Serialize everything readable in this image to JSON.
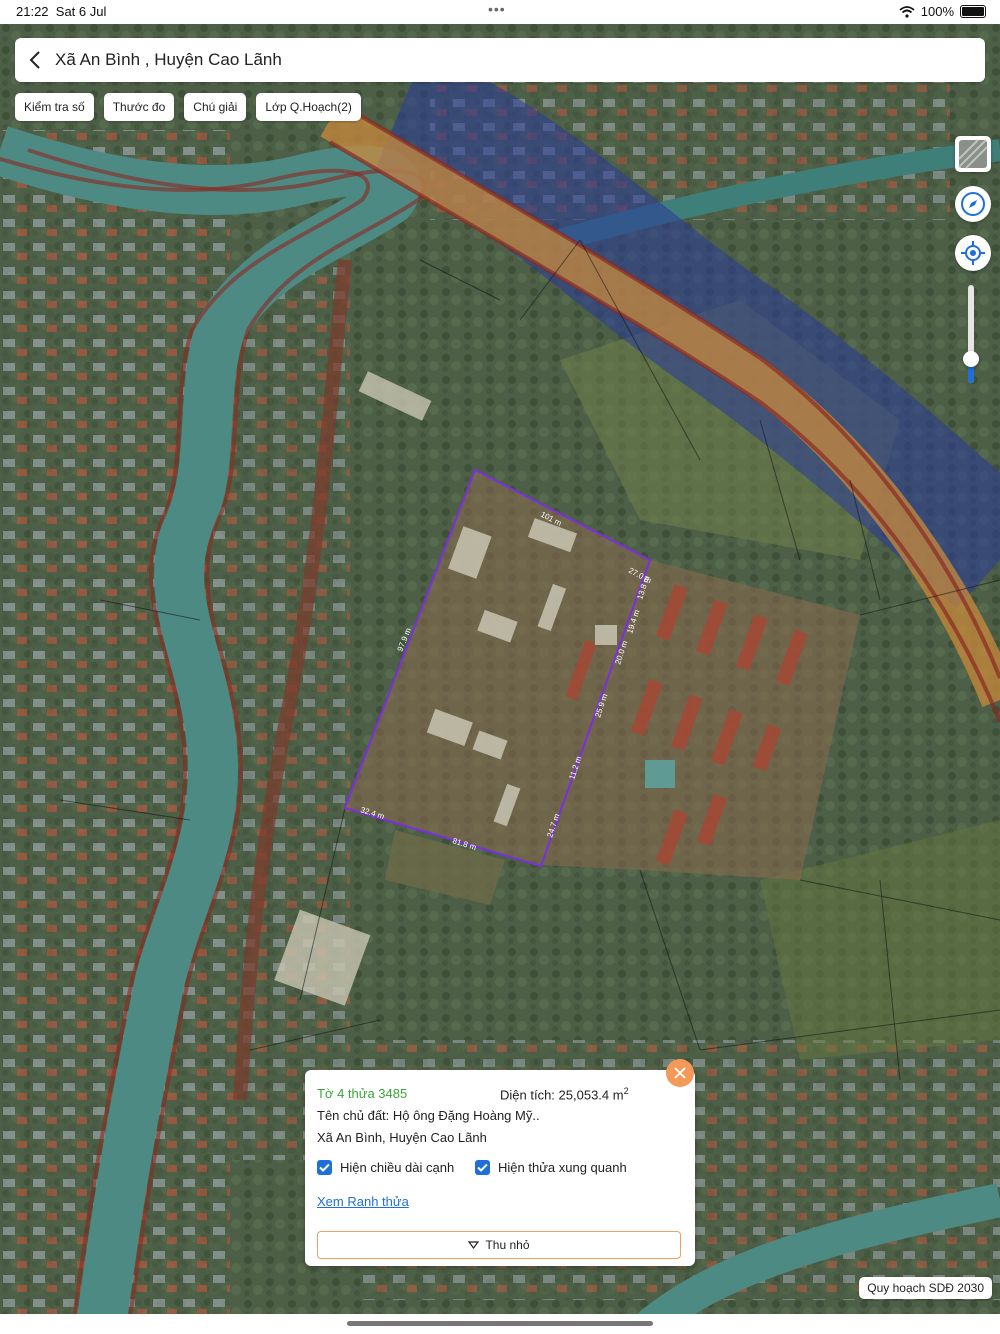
{
  "status_bar": {
    "time": "21:22",
    "date": "Sat 6 Jul",
    "battery": "100%",
    "wifi_icon": "wifi-icon"
  },
  "header": {
    "title": "Xã An Bình , Huyện Cao Lãnh",
    "back_icon": "chevron-left-icon"
  },
  "toolbar": {
    "check_number": "Kiểm tra số",
    "ruler": "Thước đo",
    "legend": "Chú giải",
    "planning_layers": "Lớp Q.Hoạch(2)"
  },
  "map_controls": {
    "layer_icon": "map-layer-icon",
    "compass_icon": "compass-icon",
    "locate_icon": "locate-icon",
    "opacity_level": 0.25
  },
  "parcel": {
    "edge_labels": [
      "101 m",
      "27.0 m",
      "13.8 m",
      "19.4 m",
      "20.0 m",
      "25.9 m",
      "11.2 m",
      "24.7 m",
      "81.8 m",
      "32.4 m",
      "97.9 m"
    ],
    "outline_color": "#7b2fe0"
  },
  "info_panel": {
    "sheet_parcel": "Tờ 4 thửa 3485",
    "area_label": "Diện tích:",
    "area_value": "25,053.4 m",
    "area_unit_sup": "2",
    "owner": "Tên chủ đất: Hộ ông Đặng Hoàng Mỹ..",
    "location": "Xã An Bình, Huyện Cao Lãnh",
    "show_edge_lengths": "Hiện chiều dài cạnh",
    "show_neighbors": "Hiện thửa xung quanh",
    "view_boundary": "Xem Ranh thửa",
    "collapse": "Thu nhỏ",
    "accent_green": "#3aa53a",
    "accent_orange": "#f39a5a"
  },
  "plan_badge": "Quy hoạch SDĐ 2030"
}
